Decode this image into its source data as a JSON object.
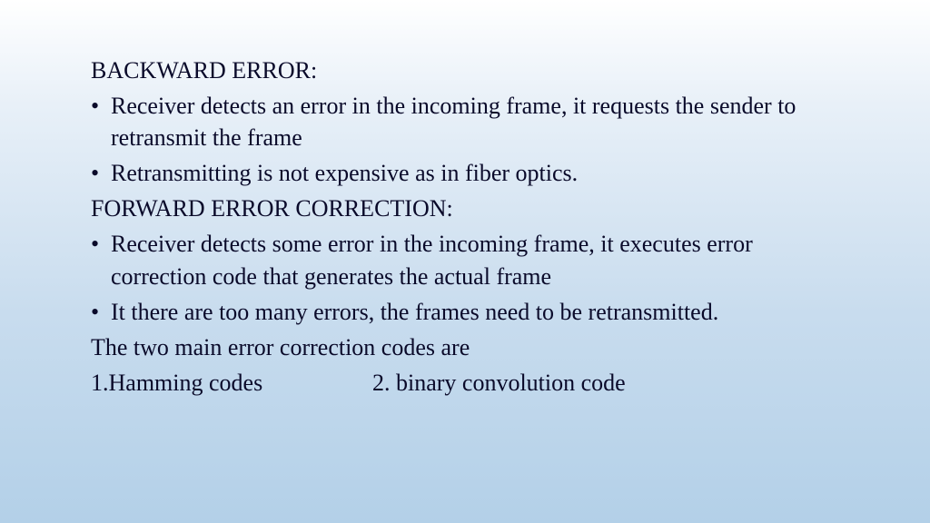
{
  "slide": {
    "heading1": "BACKWARD ERROR:",
    "bullets1": [
      "Receiver detects an error in the incoming frame, it requests the sender to retransmit the frame",
      "Retransmitting is not expensive as in fiber optics."
    ],
    "heading2": "FORWARD ERROR CORRECTION:",
    "bullets2": [
      "Receiver detects some error in the incoming frame, it executes error correction code that generates the actual frame",
      "It there are too many errors, the frames need to be retransmitted."
    ],
    "footer_line": "The two main error correction codes are",
    "item1": "1.Hamming codes",
    "item2": "2. binary convolution code",
    "bullet_char": "•"
  }
}
